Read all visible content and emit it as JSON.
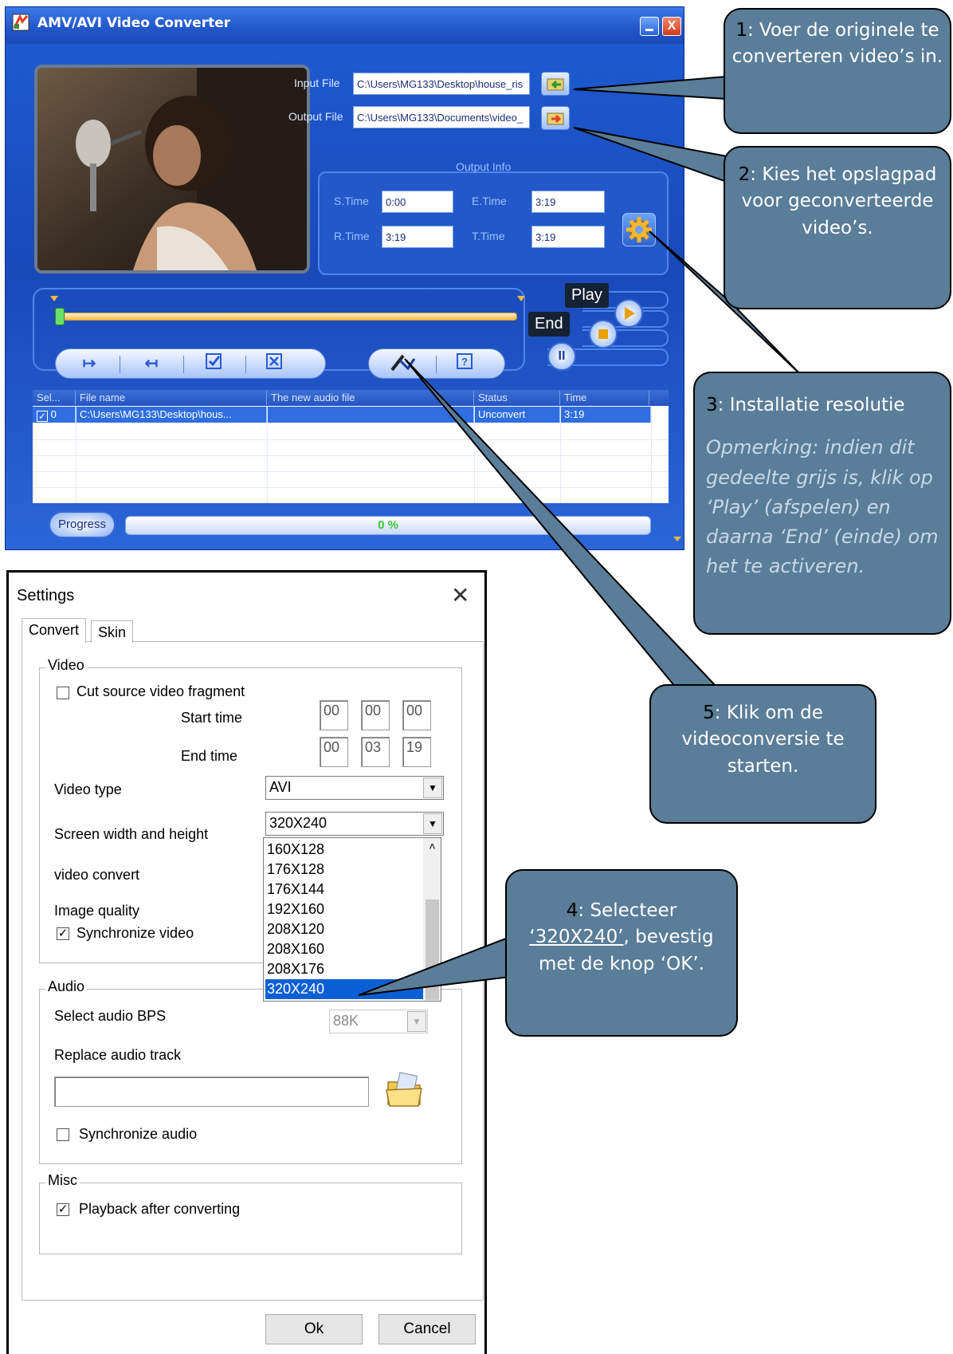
{
  "converter": {
    "title": "AMV/AVI Video Converter",
    "close_glyph": "X",
    "input_label": "Input File",
    "input_value": "C:\\Users\\MG133\\Desktop\\house_ris",
    "output_label": "Output File",
    "output_value": "C:\\Users\\MG133\\Documents\\video_",
    "output_info_label": "Output Info",
    "stime_label": "S.Time",
    "stime_value": "0:00",
    "etime_label": "E.Time",
    "etime_value": "3:19",
    "rtime_label": "R.Time",
    "rtime_value": "3:19",
    "ttime_label": "T.Time",
    "ttime_value": "3:19",
    "play_label": "Play",
    "end_label": "End",
    "pause_glyph": "II",
    "list": {
      "columns": [
        "Sel...",
        "File name",
        "The new audio file",
        "Status",
        "Time"
      ],
      "rows": [
        {
          "sel": "0",
          "file": "C:\\Users\\MG133\\Desktop\\hous...",
          "audio": "",
          "status": "Unconvert",
          "time": "3:19"
        }
      ]
    },
    "progress_label": "Progress",
    "progress_value": "0 %",
    "progress_fraction": 0
  },
  "settings": {
    "title": "Settings",
    "close_glyph": "✕",
    "tabs": [
      "Convert",
      "Skin"
    ],
    "video_group": "Video",
    "cut_fragment_label": "Cut source video fragment",
    "cut_fragment_checked": false,
    "start_time_label": "Start time",
    "start_time": [
      "00",
      "00",
      "00"
    ],
    "end_time_label": "End time",
    "end_time": [
      "00",
      "03",
      "19"
    ],
    "video_type_label": "Video type",
    "video_type_value": "AVI",
    "screen_size_label": "Screen width and height",
    "screen_size_value": "320X240",
    "screen_size_options": [
      "160X128",
      "176X128",
      "176X144",
      "192X160",
      "208X120",
      "208X160",
      "208X176",
      "320X240"
    ],
    "video_convert_label": "video convert",
    "image_quality_label": "Image quality",
    "sync_video_label": "Synchronize video",
    "sync_video_checked": true,
    "audio_group": "Audio",
    "audio_bps_label": "Select audio BPS",
    "audio_bps_value": "88K",
    "replace_audio_label": "Replace audio track",
    "replace_audio_value": "",
    "sync_audio_label": "Synchronize audio",
    "sync_audio_checked": false,
    "misc_group": "Misc",
    "playback_label": "Playback after converting",
    "playback_checked": true,
    "ok_label": "Ok",
    "cancel_label": "Cancel"
  },
  "callouts": {
    "c1_num": "1",
    "c1_text": ": Voer de originele te converteren video’s in.",
    "c2_num": "2",
    "c2_text": ": Kies het opslagpad voor geconverteerde video’s.",
    "c3_num": "3",
    "c3_text": ": Installatie resolutie",
    "c3_note": "Opmerking: indien dit gedeelte grijs is, klik op ‘Play’ (afspelen) en daarna ‘End’ (einde) om het te activeren.",
    "c4_num": "4",
    "c4_text_a": ": Selecteer",
    "c4_highlight": "‘320X240’",
    "c4_text_b": ", bevestig met de knop ‘OK’.",
    "c5_num": "5",
    "c5_text": ": Klik om de videoconversie te starten."
  },
  "colors": {
    "callout_fill": "#5a7d98",
    "converter_blue": "#1f4fbf",
    "list_selected": "#2f6ee0"
  }
}
